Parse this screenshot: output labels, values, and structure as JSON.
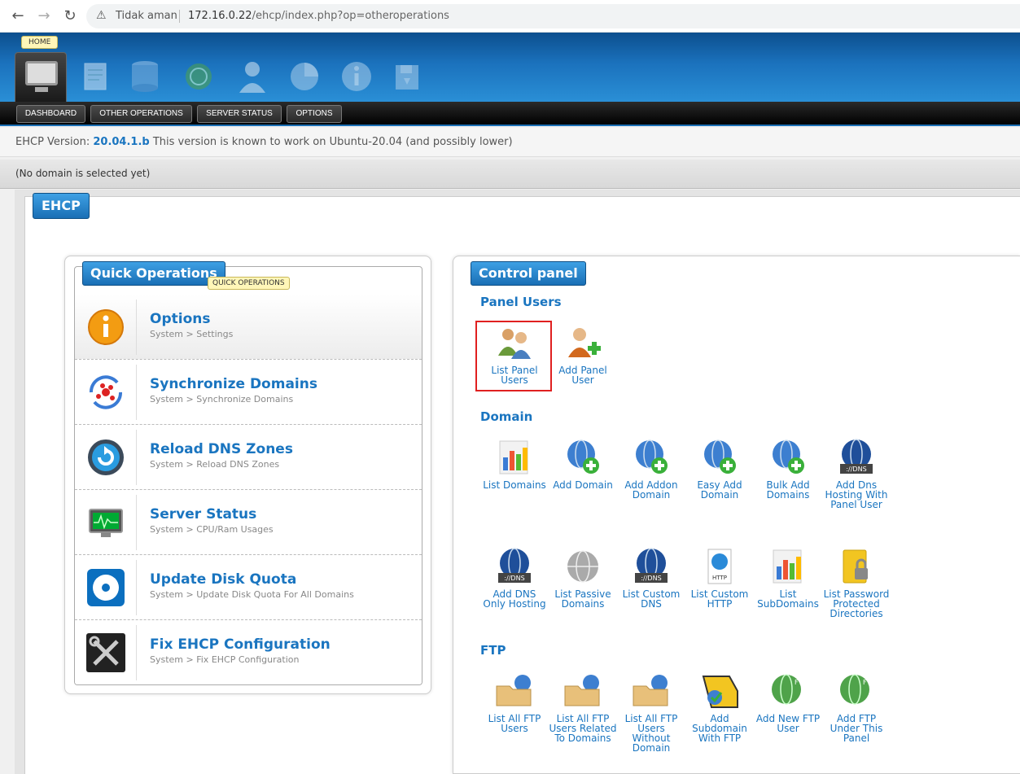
{
  "browser": {
    "security": "Tidak aman",
    "url_host": "172.16.0.22",
    "url_path": "/ehcp/index.php?op=otheroperations"
  },
  "header": {
    "home_tooltip": "HOME",
    "nav_tabs": [
      "DASHBOARD",
      "OTHER OPERATIONS",
      "SERVER STATUS",
      "OPTIONS"
    ]
  },
  "version": {
    "prefix": "EHCP Version: ",
    "number": "20.04.1.b",
    "suffix": " This version is known to work on Ubuntu-20.04 (and possibly lower)"
  },
  "domain_status": "(No domain is selected yet)",
  "frame_title": "EHCP",
  "quick_operations": {
    "title": "Quick Operations",
    "tooltip": "QUICK OPERATIONS",
    "items": [
      {
        "label": "Options",
        "sub": "System > Settings",
        "icon": "info-icon"
      },
      {
        "label": "Synchronize Domains",
        "sub": "System > Synchronize Domains",
        "icon": "sync-icon"
      },
      {
        "label": "Reload DNS Zones",
        "sub": "System > Reload DNS Zones",
        "icon": "reload-icon"
      },
      {
        "label": "Server Status",
        "sub": "System > CPU/Ram Usages",
        "icon": "monitor-icon"
      },
      {
        "label": "Update Disk Quota",
        "sub": "System > Update Disk Quota For All Domains",
        "icon": "disk-icon"
      },
      {
        "label": "Fix EHCP Configuration",
        "sub": "System > Fix EHCP Configuration",
        "icon": "tools-icon"
      }
    ]
  },
  "control_panel": {
    "title": "Control panel",
    "sections": {
      "panel_users": "Panel Users",
      "domain": "Domain",
      "ftp": "FTP"
    },
    "panel_users": [
      {
        "line1": "List Panel",
        "line2": "Users"
      },
      {
        "line1": "Add Panel",
        "line2": "User"
      }
    ],
    "domain_row1": [
      {
        "line1": "List Domains",
        "line2": ""
      },
      {
        "line1": "Add Domain",
        "line2": ""
      },
      {
        "line1": "Add Addon",
        "line2": "Domain"
      },
      {
        "line1": "Easy Add",
        "line2": "Domain"
      },
      {
        "line1": "Bulk Add",
        "line2": "Domains"
      },
      {
        "line1": "Add Dns",
        "line2": "Hosting With",
        "line3": "Panel User"
      }
    ],
    "domain_row2": [
      {
        "line1": "Add DNS",
        "line2": "Only Hosting"
      },
      {
        "line1": "List Passive",
        "line2": "Domains"
      },
      {
        "line1": "List Custom",
        "line2": "DNS"
      },
      {
        "line1": "List Custom",
        "line2": "HTTP"
      },
      {
        "line1": "List",
        "line2": "SubDomains"
      },
      {
        "line1": "List Password",
        "line2": "Protected",
        "line3": "Directories"
      }
    ],
    "ftp_row": [
      {
        "line1": "List All FTP",
        "line2": "Users"
      },
      {
        "line1": "List All FTP",
        "line2": "Users Related",
        "line3": "To Domains"
      },
      {
        "line1": "List All FTP",
        "line2": "Users",
        "line3": "Without",
        "line4": "Domain"
      },
      {
        "line1": "Add",
        "line2": "Subdomain",
        "line3": "With FTP"
      },
      {
        "line1": "Add New FTP",
        "line2": "User"
      },
      {
        "line1": "Add FTP",
        "line2": "Under This",
        "line3": "Panel"
      }
    ],
    "icon_labels": {
      "dns_badge": "://DNS",
      "http_badge": "HTTP",
      "ftp_badge": "FTP"
    }
  }
}
